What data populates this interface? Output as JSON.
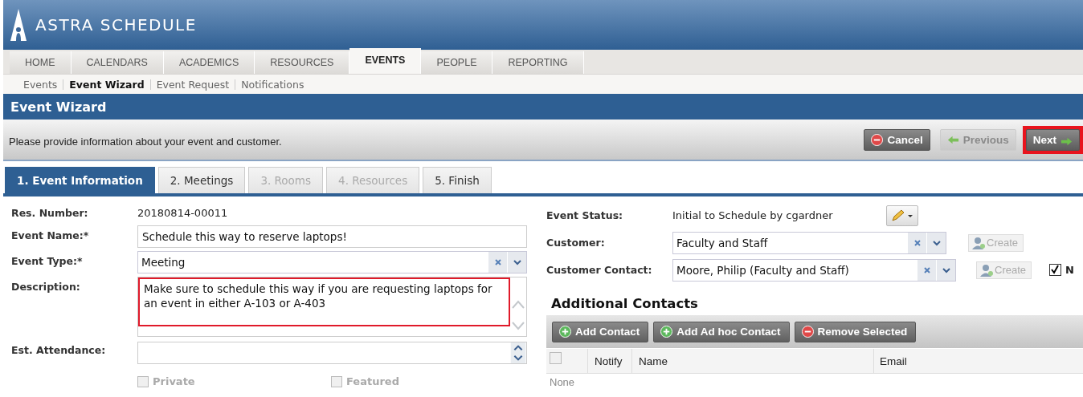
{
  "app": {
    "name": "ASTRA SCHEDULE"
  },
  "nav_tabs": [
    {
      "label": "HOME",
      "selected": false
    },
    {
      "label": "CALENDARS",
      "selected": false
    },
    {
      "label": "ACADEMICS",
      "selected": false
    },
    {
      "label": "RESOURCES",
      "selected": false
    },
    {
      "label": "EVENTS",
      "selected": true
    },
    {
      "label": "PEOPLE",
      "selected": false
    },
    {
      "label": "REPORTING",
      "selected": false
    }
  ],
  "sub_nav": [
    {
      "label": "Events",
      "selected": false
    },
    {
      "label": "Event Wizard",
      "selected": true
    },
    {
      "label": "Event Request",
      "selected": false
    },
    {
      "label": "Notifications",
      "selected": false
    }
  ],
  "page_title": "Event Wizard",
  "instruction": "Please provide information about your event and customer.",
  "wizard_buttons": [
    {
      "kind": "cancel",
      "label": "Cancel",
      "disabled": false,
      "highlighted": false
    },
    {
      "kind": "previous",
      "label": "Previous",
      "disabled": true,
      "highlighted": false
    },
    {
      "kind": "next",
      "label": "Next",
      "disabled": false,
      "highlighted": true
    }
  ],
  "steps": [
    {
      "label": "1. Event Information",
      "selected": true,
      "disabled": false
    },
    {
      "label": "2. Meetings",
      "selected": false,
      "disabled": false
    },
    {
      "label": "3. Rooms",
      "selected": false,
      "disabled": true
    },
    {
      "label": "4. Resources",
      "selected": false,
      "disabled": true
    },
    {
      "label": "5. Finish",
      "selected": false,
      "disabled": false
    }
  ],
  "left_fields": [
    {
      "kind": "static",
      "label": "Res. Number:",
      "value": "20180814-00011"
    },
    {
      "kind": "input",
      "label": "Event Name:*",
      "value": "Schedule this way to reserve laptops!"
    },
    {
      "kind": "select",
      "label": "Event Type:*",
      "value": "Meeting"
    },
    {
      "kind": "textarea",
      "label": "Description:",
      "value": "Make sure to schedule this way if you are requesting laptops for an event in either A-103 or A-403",
      "highlighted": true
    },
    {
      "kind": "number",
      "label": "Est. Attendance:"
    }
  ],
  "flags": [
    {
      "label": "Private",
      "checked": false,
      "disabled": true
    },
    {
      "label": "Featured",
      "checked": false,
      "disabled": true
    }
  ],
  "right_fields": [
    {
      "kind": "status",
      "label": "Event Status:",
      "value": "Initial to Schedule by cgardner"
    },
    {
      "kind": "select",
      "label": "Customer:",
      "value": "Faculty and Staff",
      "create": {
        "label": "Create",
        "disabled": true
      }
    },
    {
      "kind": "select",
      "label": "Customer Contact:",
      "value": "Moore, Philip (Faculty and Staff)",
      "create": {
        "label": "Create",
        "disabled": true
      },
      "notify": {
        "label": "N",
        "checked": true
      }
    }
  ],
  "additional_contacts": {
    "title": "Additional Contacts",
    "buttons": [
      {
        "kind": "add",
        "label": "Add Contact"
      },
      {
        "kind": "add",
        "label": "Add Ad hoc Contact"
      },
      {
        "kind": "remove",
        "label": "Remove Selected"
      }
    ],
    "select_all": {
      "checked": false
    },
    "columns": [
      "Notify",
      "Name",
      "Email"
    ],
    "empty_text": "None"
  }
}
